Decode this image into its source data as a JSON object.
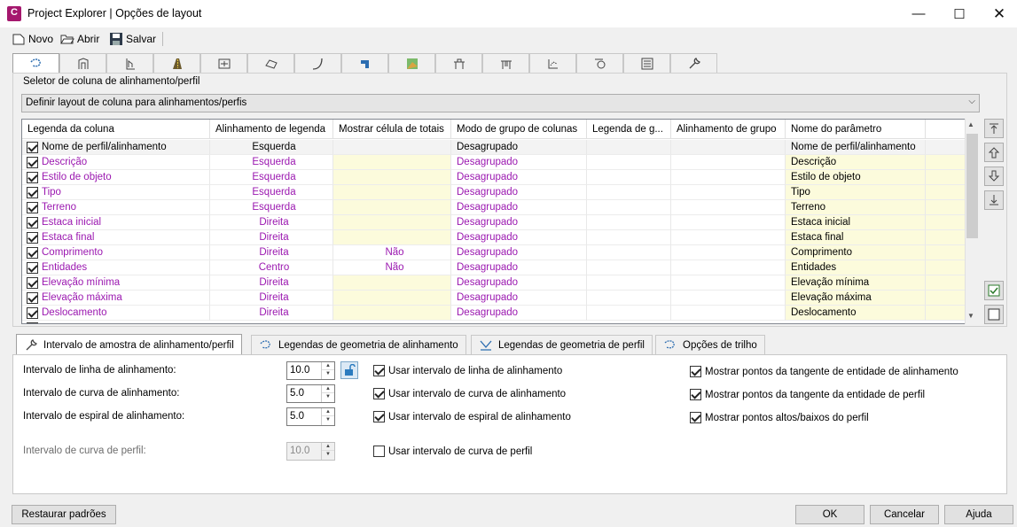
{
  "window": {
    "title": "Project Explorer | Opções de layout",
    "app_icon_letter": "C",
    "controls": [
      "minimize-icon",
      "maximize-icon",
      "close-icon"
    ]
  },
  "toolbar": {
    "novo": "Novo",
    "abrir": "Abrir",
    "salvar": "Salvar"
  },
  "icon_tabs": [
    "alignment-icon",
    "corridor-icon",
    "profile-icon",
    "road-icon",
    "section-icon",
    "surface-icon",
    "curve-icon",
    "pipe-icon",
    "parcel-icon",
    "structure-icon",
    "structure-alt-icon",
    "profile-view-icon",
    "sample-line-icon",
    "list-icon",
    "wrench-icon"
  ],
  "selector": {
    "legend": "Seletor de coluna de alinhamento/perfil",
    "combo_value": "Definir layout de coluna para alinhamentos/perfis"
  },
  "grid": {
    "headers": [
      "Legenda da coluna",
      "Alinhamento de legenda",
      "Mostrar célula de totais",
      "Modo de grupo de colunas",
      "Legenda de g...",
      "Alinhamento de grupo",
      "Nome do parâmetro"
    ],
    "rows": [
      {
        "label": "Nome de perfil/alinhamento",
        "align": "Esquerda",
        "totals": "",
        "group_mode": "Desagrupado",
        "param": "Nome de perfil/alinhamento",
        "checked": true,
        "selected": true
      },
      {
        "label": "Descrição",
        "align": "Esquerda",
        "totals": "",
        "group_mode": "Desagrupado",
        "param": "Descrição",
        "checked": true
      },
      {
        "label": "Estilo de objeto",
        "align": "Esquerda",
        "totals": "",
        "group_mode": "Desagrupado",
        "param": "Estilo de objeto",
        "checked": true
      },
      {
        "label": "Tipo",
        "align": "Esquerda",
        "totals": "",
        "group_mode": "Desagrupado",
        "param": "Tipo",
        "checked": true
      },
      {
        "label": "Terreno",
        "align": "Esquerda",
        "totals": "",
        "group_mode": "Desagrupado",
        "param": "Terreno",
        "checked": true
      },
      {
        "label": "Estaca inicial",
        "align": "Direita",
        "totals": "",
        "group_mode": "Desagrupado",
        "param": "Estaca inicial",
        "checked": true
      },
      {
        "label": "Estaca final",
        "align": "Direita",
        "totals": "",
        "group_mode": "Desagrupado",
        "param": "Estaca final",
        "checked": true
      },
      {
        "label": "Comprimento",
        "align": "Direita",
        "totals": "Não",
        "group_mode": "Desagrupado",
        "param": "Comprimento",
        "checked": true
      },
      {
        "label": "Entidades",
        "align": "Centro",
        "totals": "Não",
        "group_mode": "Desagrupado",
        "param": "Entidades",
        "checked": true
      },
      {
        "label": "Elevação mínima",
        "align": "Direita",
        "totals": "",
        "group_mode": "Desagrupado",
        "param": "Elevação mínima",
        "checked": true
      },
      {
        "label": "Elevação máxima",
        "align": "Direita",
        "totals": "",
        "group_mode": "Desagrupado",
        "param": "Elevação máxima",
        "checked": true
      },
      {
        "label": "Deslocamento",
        "align": "Direita",
        "totals": "",
        "group_mode": "Desagrupado",
        "param": "Deslocamento",
        "checked": true
      }
    ]
  },
  "side_buttons": [
    "move-top-icon",
    "move-up-icon",
    "move-down-icon",
    "move-bottom-icon",
    "check-all-icon",
    "uncheck-all-icon"
  ],
  "bottom_tabs": [
    {
      "label": "Intervalo de amostra de alinhamento/perfil",
      "icon": "wrench-icon"
    },
    {
      "label": "Legendas de geometria de alinhamento",
      "icon": "alignment-icon"
    },
    {
      "label": "Legendas de geometria de perfil",
      "icon": "profile-icon"
    },
    {
      "label": "Opções de trilho",
      "icon": "rail-icon"
    }
  ],
  "interval": {
    "line_label": "Intervalo de linha de alinhamento:",
    "line_value": "10.0",
    "curve_label": "Intervalo de curva de alinhamento:",
    "curve_value": "5.0",
    "spiral_label": "Intervalo de espiral de alinhamento:",
    "spiral_value": "5.0",
    "profile_curve_label": "Intervalo de curva de perfil:",
    "profile_curve_value": "10.0"
  },
  "checks": {
    "use_line": "Usar intervalo de linha de alinhamento",
    "use_curve": "Usar intervalo de curva de alinhamento",
    "use_spiral": "Usar intervalo de espiral de alinhamento",
    "use_profile_curve": "Usar intervalo de curva de perfil",
    "show_align_tangent": "Mostrar pontos da tangente de entidade de alinhamento",
    "show_profile_tangent": "Mostrar pontos da tangente da entidade de perfil",
    "show_high_low": "Mostrar pontos altos/baixos do perfil"
  },
  "buttons": {
    "restore": "Restaurar padrões",
    "ok": "OK",
    "cancel": "Cancelar",
    "help": "Ajuda"
  }
}
